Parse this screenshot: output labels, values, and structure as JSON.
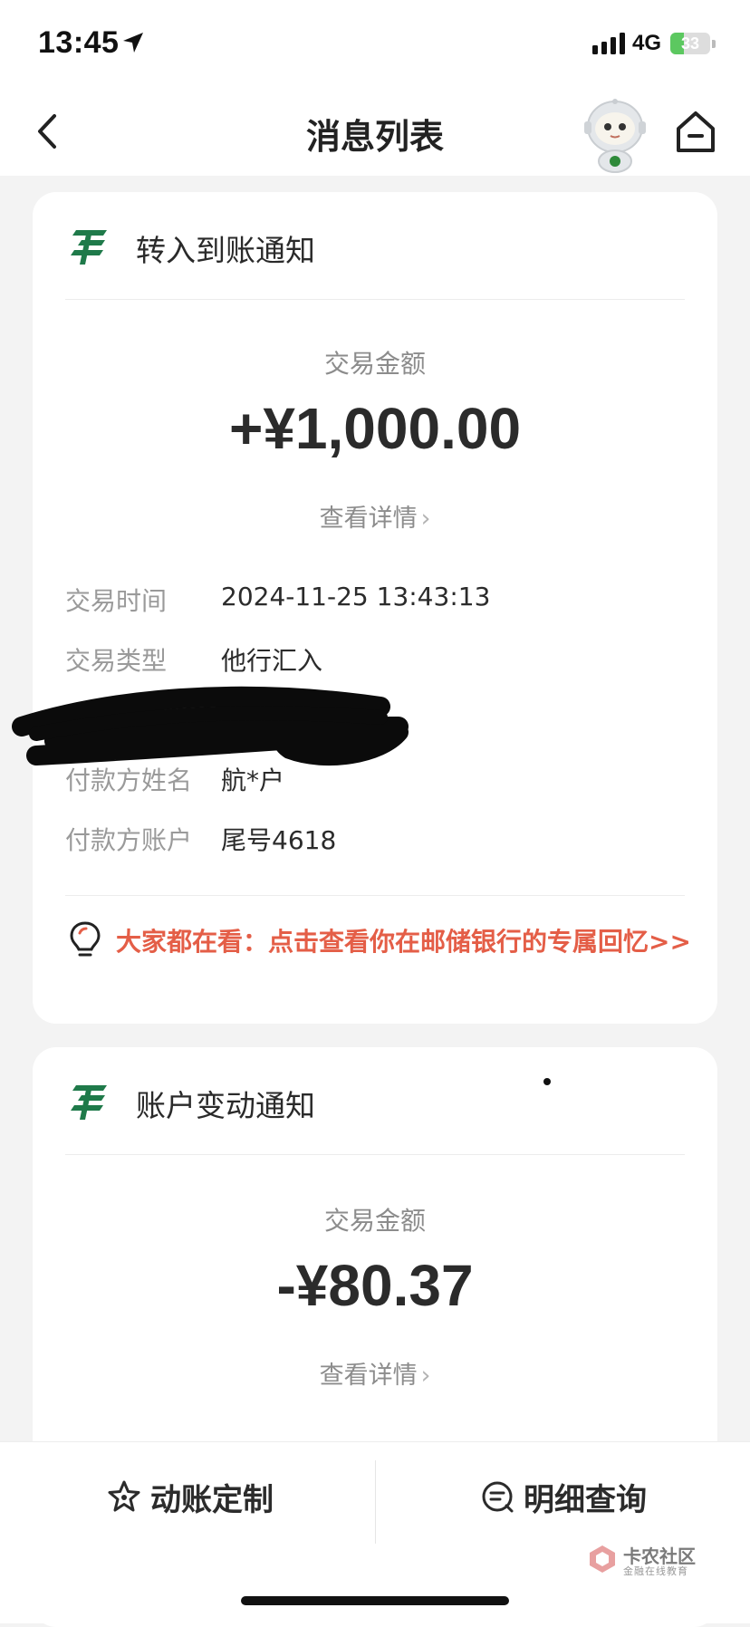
{
  "status_bar": {
    "time": "13:45",
    "network": "4G",
    "battery": "33",
    "battery_level": 0.33
  },
  "nav": {
    "title": "消息列表",
    "icons": [
      "back-arrow-icon",
      "mascot-robot-icon",
      "home-icon"
    ]
  },
  "cards": [
    {
      "title": "转入到账通知",
      "amount_label": "交易金额",
      "amount": "+¥1,000.00",
      "detail_link": "查看详情",
      "rows": [
        {
          "label": "交易时间",
          "value": "2024-11-25 13:43:13"
        },
        {
          "label": "交易类型",
          "value": "他行汇入"
        },
        {
          "label": "付款方姓名",
          "value": "航*户"
        },
        {
          "label": "付款方账户",
          "value": "尾号4618"
        }
      ],
      "tip": "大家都在看：点击查看你在邮储银行的专属回忆>>"
    },
    {
      "title": "账户变动通知",
      "amount_label": "交易金额",
      "amount": "-¥80.37",
      "detail_link": "查看详情"
    }
  ],
  "bottom_bar": {
    "left_label": "动账定制",
    "right_label": "明细查询"
  },
  "watermark": {
    "title": "卡农社区",
    "subtitle": "金融在线教育"
  },
  "colors": {
    "brand_green": "#1f7a4a",
    "tip_red": "#e45e47",
    "background": "#f3f3f3"
  }
}
